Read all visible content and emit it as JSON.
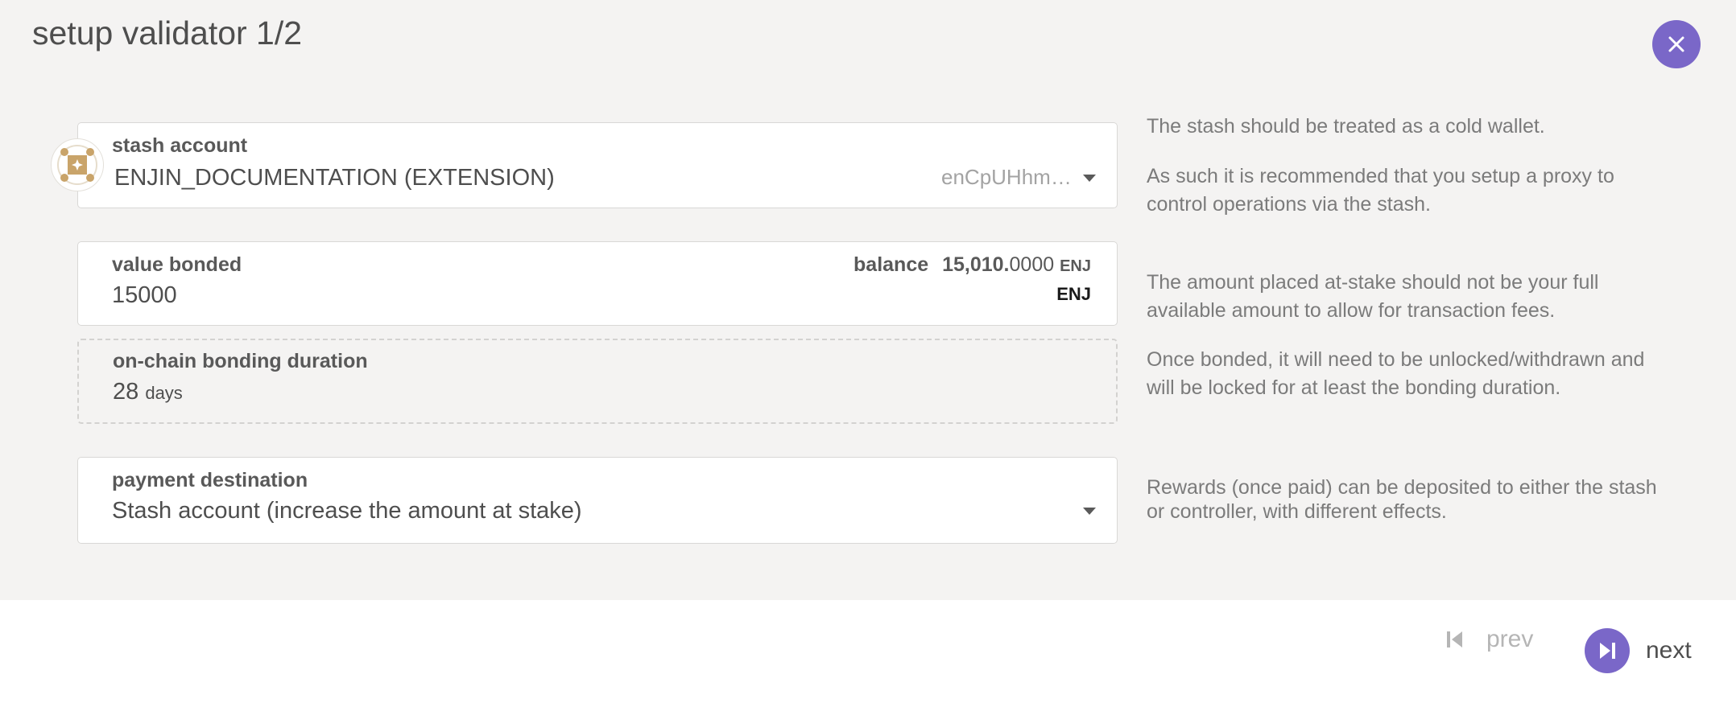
{
  "title": "setup validator 1/2",
  "colors": {
    "accent": "#7a67c8",
    "panel": "#f4f3f2",
    "avatar_gold": "#c9a46a"
  },
  "stash": {
    "label": "stash account",
    "account_name": "ENJIN_DOCUMENTATION (EXTENSION)",
    "address_short": "enCpUHhm…",
    "avatar_icon": "identicon-avatar",
    "hint_1": "The stash should be treated as a cold wallet.",
    "hint_2a": "As such it is recommended that you setup a proxy to",
    "hint_2b": "control operations via the stash."
  },
  "bond": {
    "label": "value bonded",
    "value": "15000",
    "unit": "ENJ",
    "balance_label": "balance",
    "balance_int": "15,010.",
    "balance_dec": "0000",
    "balance_unit": "ENJ",
    "hint_a": "The amount placed at-stake should not be your full",
    "hint_b": "available amount to allow for transaction fees."
  },
  "duration": {
    "label": "on-chain bonding duration",
    "value": "28",
    "unit": "days",
    "hint_a": "Once bonded, it will need to be unlocked/withdrawn and",
    "hint_b": "will be locked for at least the bonding duration."
  },
  "payment": {
    "label": "payment destination",
    "value": "Stash account (increase the amount at stake)",
    "hint_a": "Rewards (once paid) can be deposited to either the stash",
    "hint_b": "or controller, with different effects."
  },
  "footer": {
    "prev_label": "prev",
    "next_label": "next"
  }
}
